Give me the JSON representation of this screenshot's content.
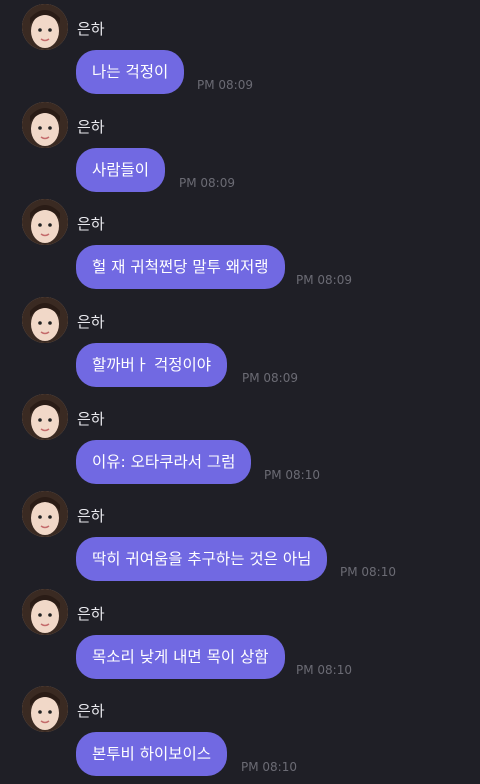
{
  "accent": "#7169e2",
  "background": "#1f1f26",
  "messages": [
    {
      "sender": "은하",
      "text": "나는 걱정이",
      "time": "PM 08:09"
    },
    {
      "sender": "은하",
      "text": "사람들이",
      "time": "PM 08:09"
    },
    {
      "sender": "은하",
      "text": "헐 재 귀척쩐당 말투 왜저랭",
      "time": "PM 08:09"
    },
    {
      "sender": "은하",
      "text": "할까버ㅏ 걱정이야",
      "time": "PM 08:09"
    },
    {
      "sender": "은하",
      "text": "이유: 오타쿠라서 그럼",
      "time": "PM 08:10"
    },
    {
      "sender": "은하",
      "text": "딱히 귀여움을 추구하는 것은 아님",
      "time": "PM 08:10"
    },
    {
      "sender": "은하",
      "text": "목소리 낮게 내면 목이 상함",
      "time": "PM 08:10"
    },
    {
      "sender": "은하",
      "text": "본투비 하이보이스",
      "time": "PM 08:10"
    }
  ]
}
